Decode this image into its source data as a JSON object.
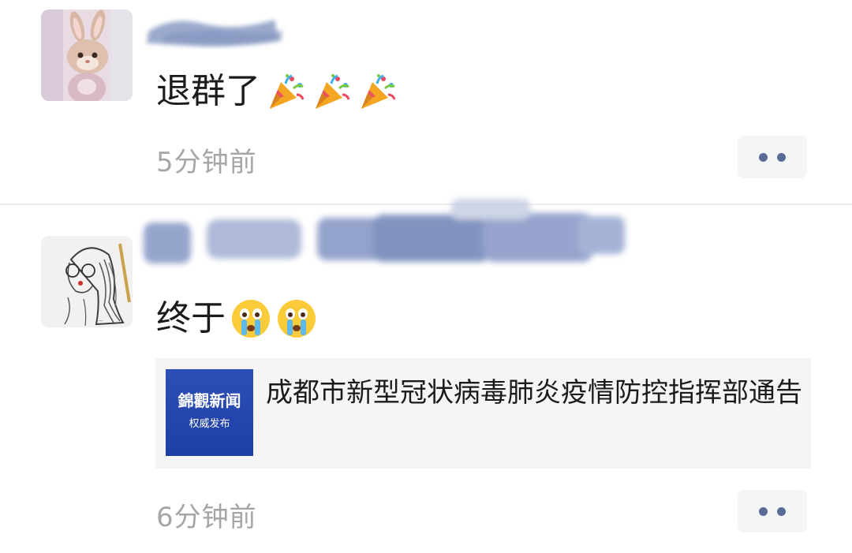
{
  "posts": [
    {
      "message": "退群了",
      "emojis": [
        "party-popper",
        "party-popper",
        "party-popper"
      ],
      "time": "5分钟前"
    },
    {
      "message": "终于",
      "emojis": [
        "loudly-crying-face",
        "loudly-crying-face"
      ],
      "time": "6分钟前",
      "link_card": {
        "thumb_brand": "錦觀新闻",
        "thumb_sub": "权威发布",
        "title": "成都市新型冠状病毒肺炎疫情防控指挥部通告"
      }
    }
  ],
  "colors": {
    "link_blue": "#576b95",
    "time_gray": "#a6a6a6",
    "card_bg": "#f5f5f5",
    "thumb_blue": "#2646ad"
  },
  "icons": {
    "more": "two-dots-icon",
    "avatar1": "bunny-plush-avatar",
    "avatar2": "sketch-girl-avatar"
  }
}
